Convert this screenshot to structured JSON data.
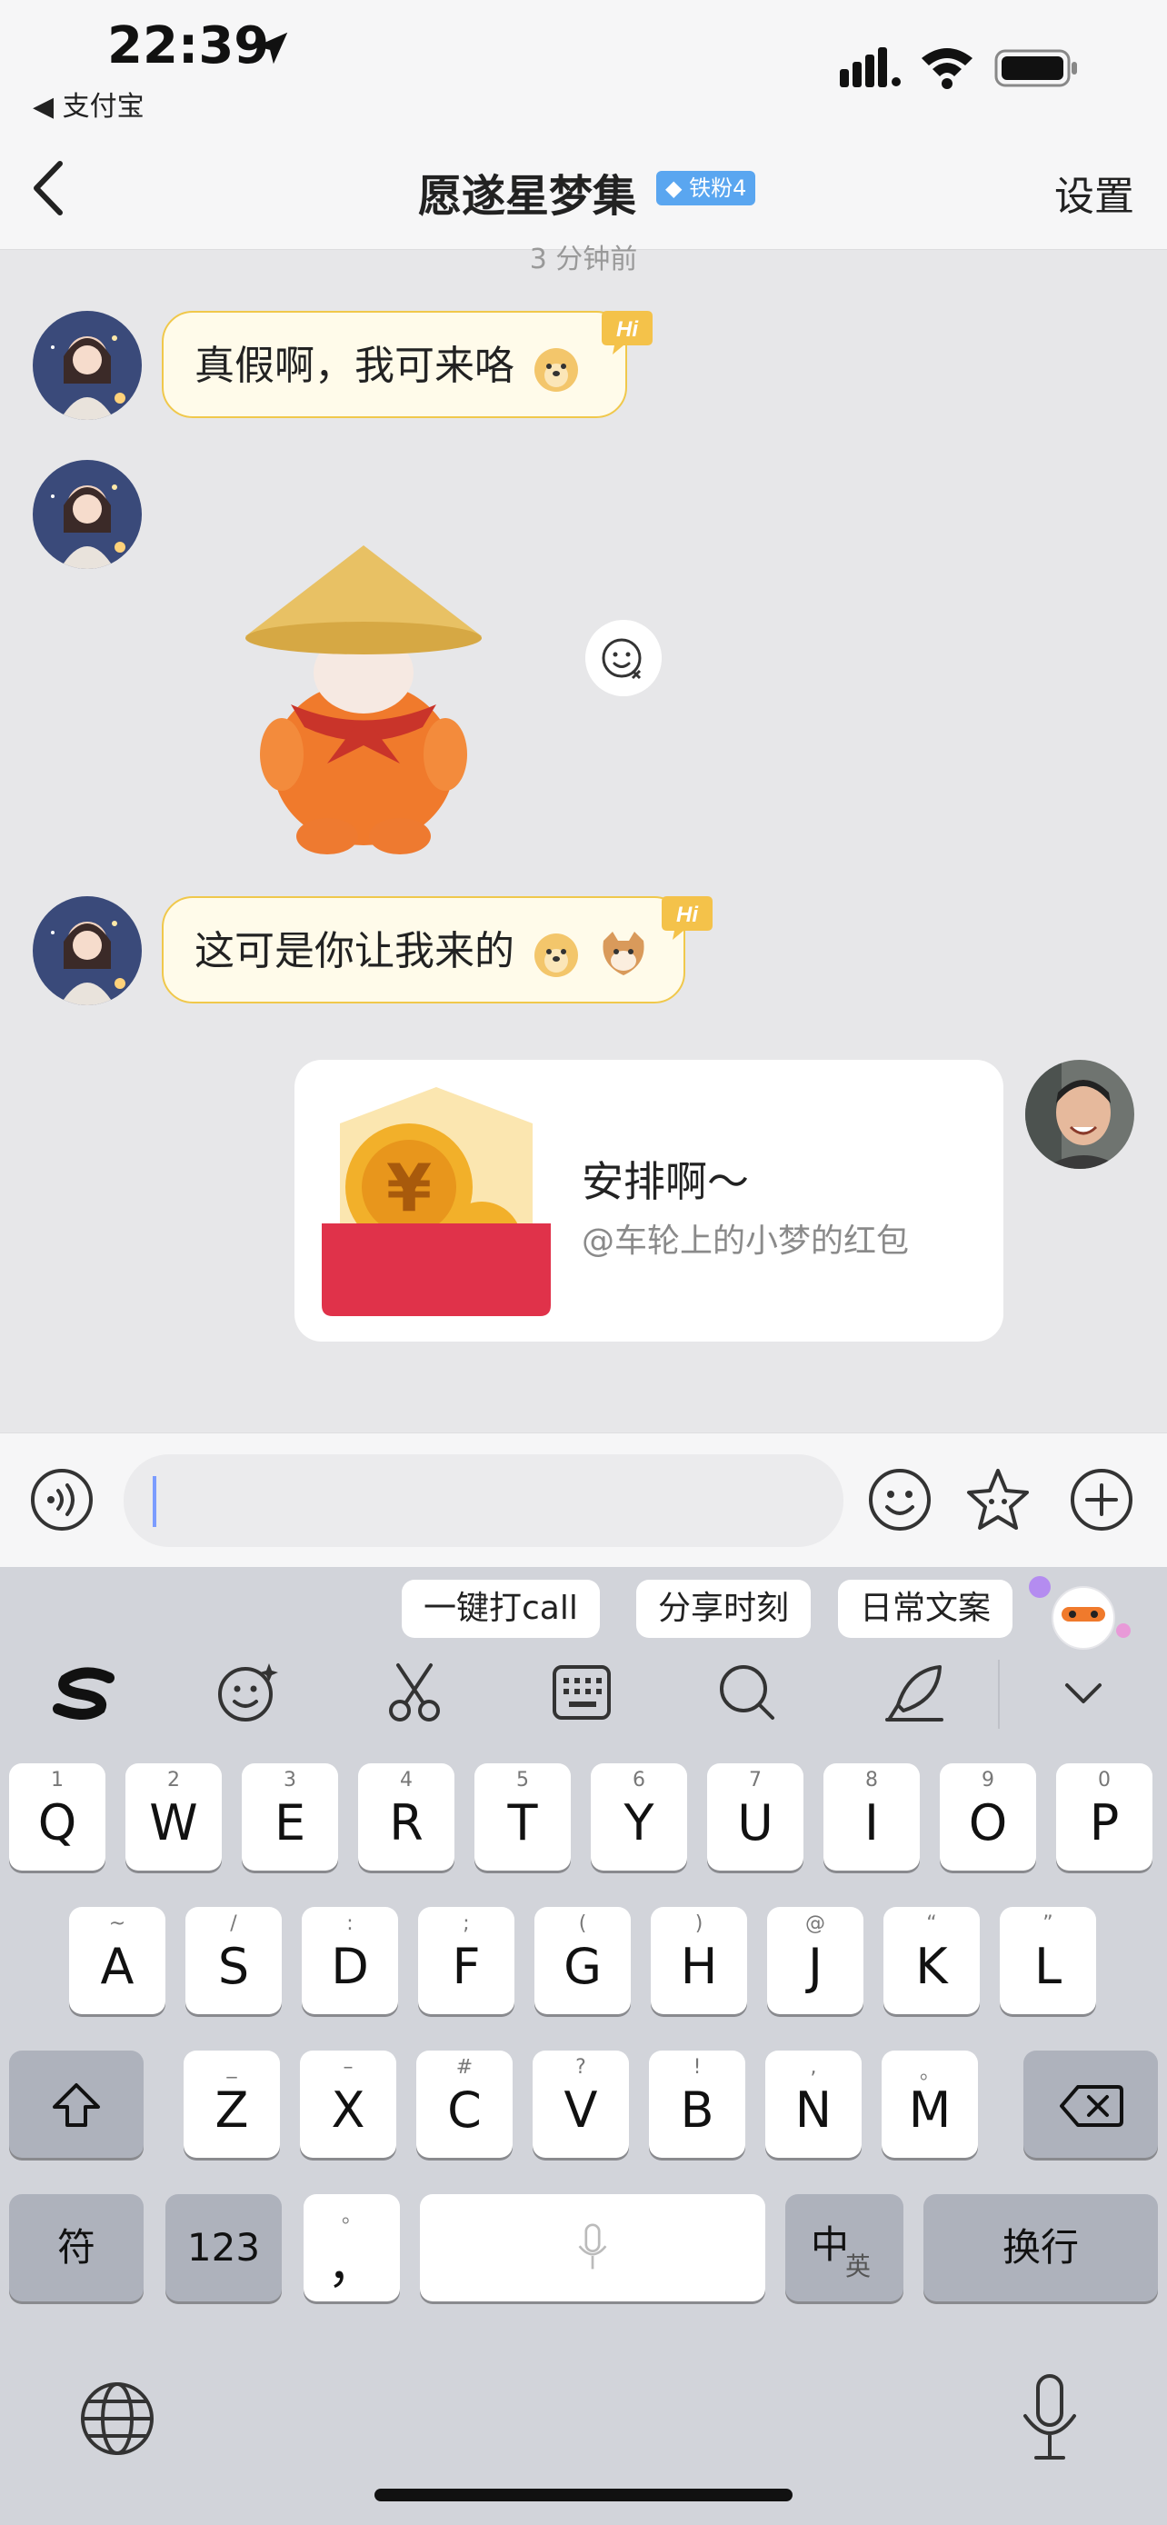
{
  "status_bar": {
    "time": "22:39",
    "back_app": "◀ 支付宝"
  },
  "nav": {
    "title": "愿遂星梦集",
    "badge": "铁粉4",
    "settings": "设置"
  },
  "chat": {
    "time_separator": "3 分钟前",
    "messages": [
      {
        "text": "真假啊，我可来咯",
        "hi": "Hi"
      },
      {
        "text": "这可是你让我来的",
        "hi": "Hi"
      }
    ],
    "red_packet": {
      "title": "安排啊～",
      "subtitle": "@车轮上的小梦的红包"
    }
  },
  "keyboard": {
    "chips": [
      "一键打call",
      "分享时刻",
      "日常文案"
    ],
    "row1": [
      {
        "k": "Q",
        "s": "1"
      },
      {
        "k": "W",
        "s": "2"
      },
      {
        "k": "E",
        "s": "3"
      },
      {
        "k": "R",
        "s": "4"
      },
      {
        "k": "T",
        "s": "5"
      },
      {
        "k": "Y",
        "s": "6"
      },
      {
        "k": "U",
        "s": "7"
      },
      {
        "k": "I",
        "s": "8"
      },
      {
        "k": "O",
        "s": "9"
      },
      {
        "k": "P",
        "s": "0"
      }
    ],
    "row2": [
      {
        "k": "A",
        "s": "~"
      },
      {
        "k": "S",
        "s": "/"
      },
      {
        "k": "D",
        "s": ":"
      },
      {
        "k": "F",
        "s": ";"
      },
      {
        "k": "G",
        "s": "("
      },
      {
        "k": "H",
        "s": ")"
      },
      {
        "k": "J",
        "s": "@"
      },
      {
        "k": "K",
        "s": "“"
      },
      {
        "k": "L",
        "s": "”"
      }
    ],
    "row3": [
      {
        "k": "Z",
        "s": "_"
      },
      {
        "k": "X",
        "s": "–"
      },
      {
        "k": "C",
        "s": "#"
      },
      {
        "k": "V",
        "s": "?"
      },
      {
        "k": "B",
        "s": "!"
      },
      {
        "k": "N",
        "s": ","
      },
      {
        "k": "M",
        "s": "。"
      }
    ],
    "symbols_key": "符",
    "numbers_key": "123",
    "comma_key": "，",
    "comma_sub": "。",
    "lang_key": "中",
    "lang_key_sub": "英",
    "return_key": "换行"
  }
}
